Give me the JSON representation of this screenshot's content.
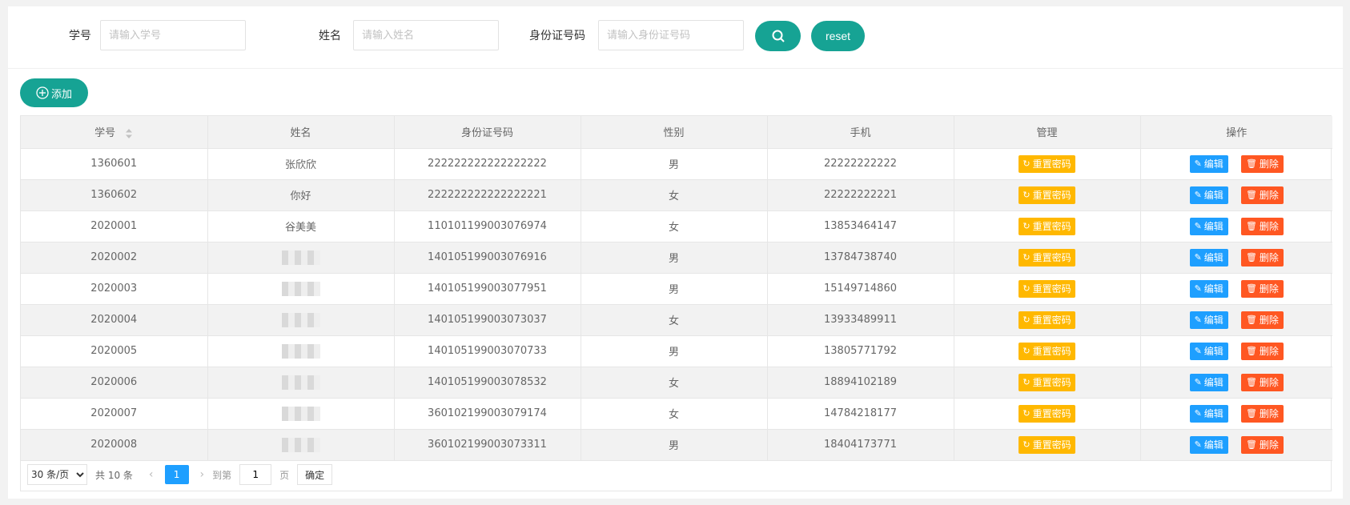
{
  "search": {
    "student_id_label": "学号",
    "student_id_placeholder": "请输入学号",
    "name_label": "姓名",
    "name_placeholder": "请输入姓名",
    "id_card_label": "身份证号码",
    "id_card_placeholder": "请输入身份证号码",
    "reset_label": "reset"
  },
  "toolbar": {
    "add_label": "添加"
  },
  "table": {
    "headers": [
      "学号",
      "姓名",
      "身份证号码",
      "性别",
      "手机",
      "管理",
      "操作"
    ],
    "rows": [
      {
        "id": "1360601",
        "name": "张欣欣",
        "id_card": "222222222222222222",
        "gender": "男",
        "phone": "22222222222"
      },
      {
        "id": "1360602",
        "name": "你好",
        "id_card": "222222222222222221",
        "gender": "女",
        "phone": "22222222221"
      },
      {
        "id": "2020001",
        "name": "谷美美",
        "id_card": "110101199003076974",
        "gender": "女",
        "phone": "13853464147"
      },
      {
        "id": "2020002",
        "name": "",
        "id_card": "140105199003076916",
        "gender": "男",
        "phone": "13784738740"
      },
      {
        "id": "2020003",
        "name": "",
        "id_card": "140105199003077951",
        "gender": "男",
        "phone": "15149714860"
      },
      {
        "id": "2020004",
        "name": "",
        "id_card": "140105199003073037",
        "gender": "女",
        "phone": "13933489911"
      },
      {
        "id": "2020005",
        "name": "",
        "id_card": "140105199003070733",
        "gender": "男",
        "phone": "13805771792"
      },
      {
        "id": "2020006",
        "name": "",
        "id_card": "140105199003078532",
        "gender": "女",
        "phone": "18894102189"
      },
      {
        "id": "2020007",
        "name": "",
        "id_card": "360102199003079174",
        "gender": "女",
        "phone": "14784218177"
      },
      {
        "id": "2020008",
        "name": "",
        "id_card": "360102199003073311",
        "gender": "男",
        "phone": "18404173771"
      }
    ],
    "reset_pw_label": "重置密码",
    "edit_label": "编辑",
    "delete_label": "删除"
  },
  "pager": {
    "page_size": "30 条/页",
    "total": "共 10 条",
    "current_page": "1",
    "goto_label": "到第",
    "goto_value": "1",
    "page_unit": "页",
    "confirm_label": "确定"
  },
  "colors": {
    "primary": "#16a394",
    "warn": "#ffb800",
    "info": "#1e9fff",
    "danger": "#ff5722"
  }
}
